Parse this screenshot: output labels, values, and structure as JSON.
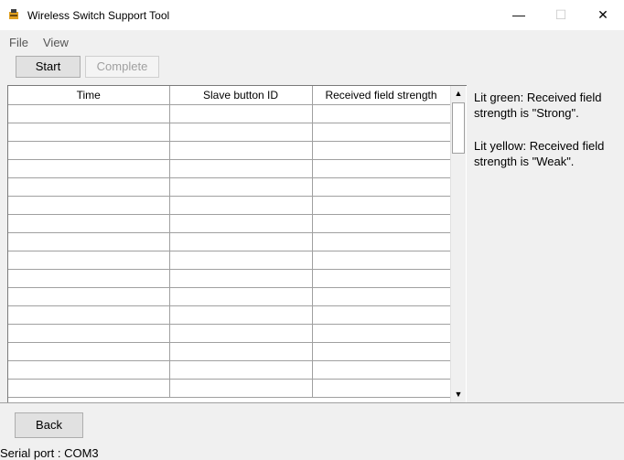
{
  "window": {
    "title": "Wireless Switch Support Tool",
    "minimize_glyph": "—",
    "maximize_glyph": "☐",
    "close_glyph": "✕"
  },
  "menu": {
    "file": "File",
    "view": "View"
  },
  "toolbar": {
    "start_label": "Start",
    "complete_label": "Complete"
  },
  "table": {
    "columns": [
      "Time",
      "Slave button ID",
      "Received field strength"
    ],
    "rows": [
      [
        "",
        "",
        ""
      ],
      [
        "",
        "",
        ""
      ],
      [
        "",
        "",
        ""
      ],
      [
        "",
        "",
        ""
      ],
      [
        "",
        "",
        ""
      ],
      [
        "",
        "",
        ""
      ],
      [
        "",
        "",
        ""
      ],
      [
        "",
        "",
        ""
      ],
      [
        "",
        "",
        ""
      ],
      [
        "",
        "",
        ""
      ],
      [
        "",
        "",
        ""
      ],
      [
        "",
        "",
        ""
      ],
      [
        "",
        "",
        ""
      ],
      [
        "",
        "",
        ""
      ],
      [
        "",
        "",
        ""
      ],
      [
        "",
        "",
        ""
      ]
    ]
  },
  "info": {
    "green": "Lit green: Received field strength is \"Strong\".",
    "yellow": "Lit yellow: Received field strength is \"Weak\"."
  },
  "footer": {
    "back_label": "Back",
    "serial_port": "Serial port : COM3"
  }
}
